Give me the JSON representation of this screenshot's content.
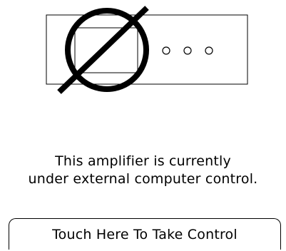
{
  "status": {
    "message_line1": "This amplifier is currently",
    "message_line2": "under external computer control."
  },
  "actions": {
    "take_control_label": "Touch Here To Take Control"
  },
  "icons": {
    "amplifier": "amplifier-icon",
    "prohibited": "prohibited-icon"
  }
}
